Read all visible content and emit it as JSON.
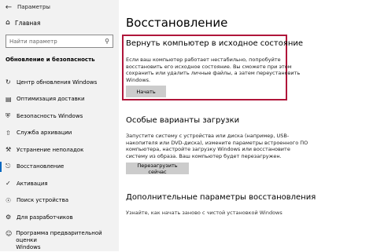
{
  "window": {
    "title": "Параметры",
    "back_icon": "back-arrow-icon"
  },
  "sidebar": {
    "home": "Главная",
    "search_placeholder": "Найти параметр",
    "section": "Обновление и безопасность",
    "items": [
      {
        "label": "Центр обновления Windows",
        "icon": "refresh-icon",
        "active": false
      },
      {
        "label": "Оптимизация доставки",
        "icon": "delivery-icon",
        "active": false
      },
      {
        "label": "Безопасность Windows",
        "icon": "shield-icon",
        "active": false
      },
      {
        "label": "Служба архивации",
        "icon": "backup-icon",
        "active": false
      },
      {
        "label": "Устранение неполадок",
        "icon": "wrench-icon",
        "active": false
      },
      {
        "label": "Восстановление",
        "icon": "recovery-icon",
        "active": true
      },
      {
        "label": "Активация",
        "icon": "activation-icon",
        "active": false
      },
      {
        "label": "Поиск устройства",
        "icon": "find-device-icon",
        "active": false
      },
      {
        "label": "Для разработчиков",
        "icon": "developer-icon",
        "active": false
      },
      {
        "label": "Программа предварительной оценки Windows",
        "label_line1": "Программа предварительной оценки",
        "label_line2": "Windows",
        "icon": "insider-icon",
        "active": false
      }
    ]
  },
  "main": {
    "title": "Восстановление",
    "reset": {
      "heading": "Вернуть компьютер в исходное состояние",
      "desc1": "Если ваш компьютер работает нестабильно, попробуйте",
      "desc2": "восстановить его исходное состояние. Вы сможете при этом",
      "desc3": "сохранить или удалить личные файлы, а затем переустановить",
      "desc4": "Windows.",
      "button": "Начать",
      "highlight_color": "#b0163a"
    },
    "advanced": {
      "heading": "Особые варианты загрузки",
      "desc1": "Запустите систему с устройства или диска (например, USB-",
      "desc2": "накопителя или DVD-диска), измените параметры встроенного ПО",
      "desc3": "компьютера, настройте загрузку Windows или восстановите",
      "desc4": "систему из образа. Ваш компьютер будет перезагружен.",
      "button": "Перезагрузить сейчас"
    },
    "more": {
      "heading": "Дополнительные параметры восстановления",
      "link": "Узнайте, как начать заново с чистой установкой Windows"
    }
  },
  "colors": {
    "accent": "#0067c0",
    "sidebar_bg": "#f2f2f2",
    "button_bg": "#cccccc"
  }
}
